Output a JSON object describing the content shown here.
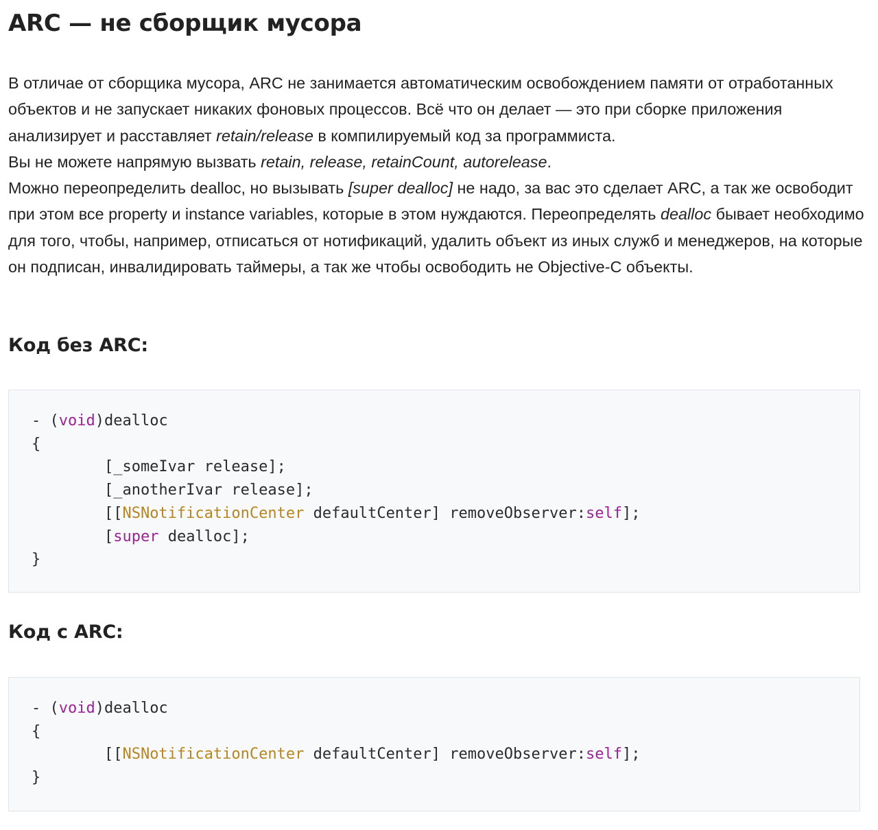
{
  "title": "ARC — не сборщик мусора",
  "paragraphs": {
    "p1_a": "В отличае от сборщика мусора, ARC не занимается автоматическим освобождением памяти от отработанных объектов и не запускает никаких фоновых процессов. Всё что он делает — это при сборке приложения анализирует и расставляет ",
    "p1_em": "retain/release",
    "p1_b": " в компилируемый код за программиста.",
    "p2_a": "Вы не можете напрямую вызвать ",
    "p2_em": "retain, release, retainCount, autorelease",
    "p2_b": ".",
    "p3_a": "Можно переопределить dealloc, но вызывать ",
    "p3_em1": "[super dealloc]",
    "p3_b": " не надо, за вас это сделает ARC, а так же освободит при этом все property и instance variables, которые в этом нуждаются. Переопределять ",
    "p3_em2": "dealloc",
    "p3_c": " бывает необходимо для того, чтобы, например, отписаться от нотификаций, удалить объект из иных служб и менеджеров, на которые он подписан, инвалидировать таймеры, а так же чтобы освободить не Objective-C объекты."
  },
  "section_without_arc": {
    "heading": "Код без ARC:",
    "code": {
      "l1_a": "- (",
      "l1_kw": "void",
      "l1_b": ")dealloc",
      "l2": "{",
      "l3": "        [_someIvar release];",
      "l4": "        [_anotherIvar release];",
      "l5_a": "        [[",
      "l5_cls": "NSNotificationCenter",
      "l5_b": " defaultCenter] removeObserver:",
      "l5_kw": "self",
      "l5_c": "];",
      "l6_a": "        [",
      "l6_kw": "super",
      "l6_b": " dealloc];",
      "l7": "}"
    }
  },
  "section_with_arc": {
    "heading": "Код с ARC:",
    "code": {
      "l1_a": "- (",
      "l1_kw": "void",
      "l1_b": ")dealloc",
      "l2": "{",
      "l3_a": "        [[",
      "l3_cls": "NSNotificationCenter",
      "l3_b": " defaultCenter] removeObserver:",
      "l3_kw": "self",
      "l3_c": "];",
      "l4": "}"
    }
  },
  "colors": {
    "keyword": "#9b2393",
    "class_name": "#b7861f",
    "code_background": "#f8f9fb",
    "text": "#222222"
  }
}
